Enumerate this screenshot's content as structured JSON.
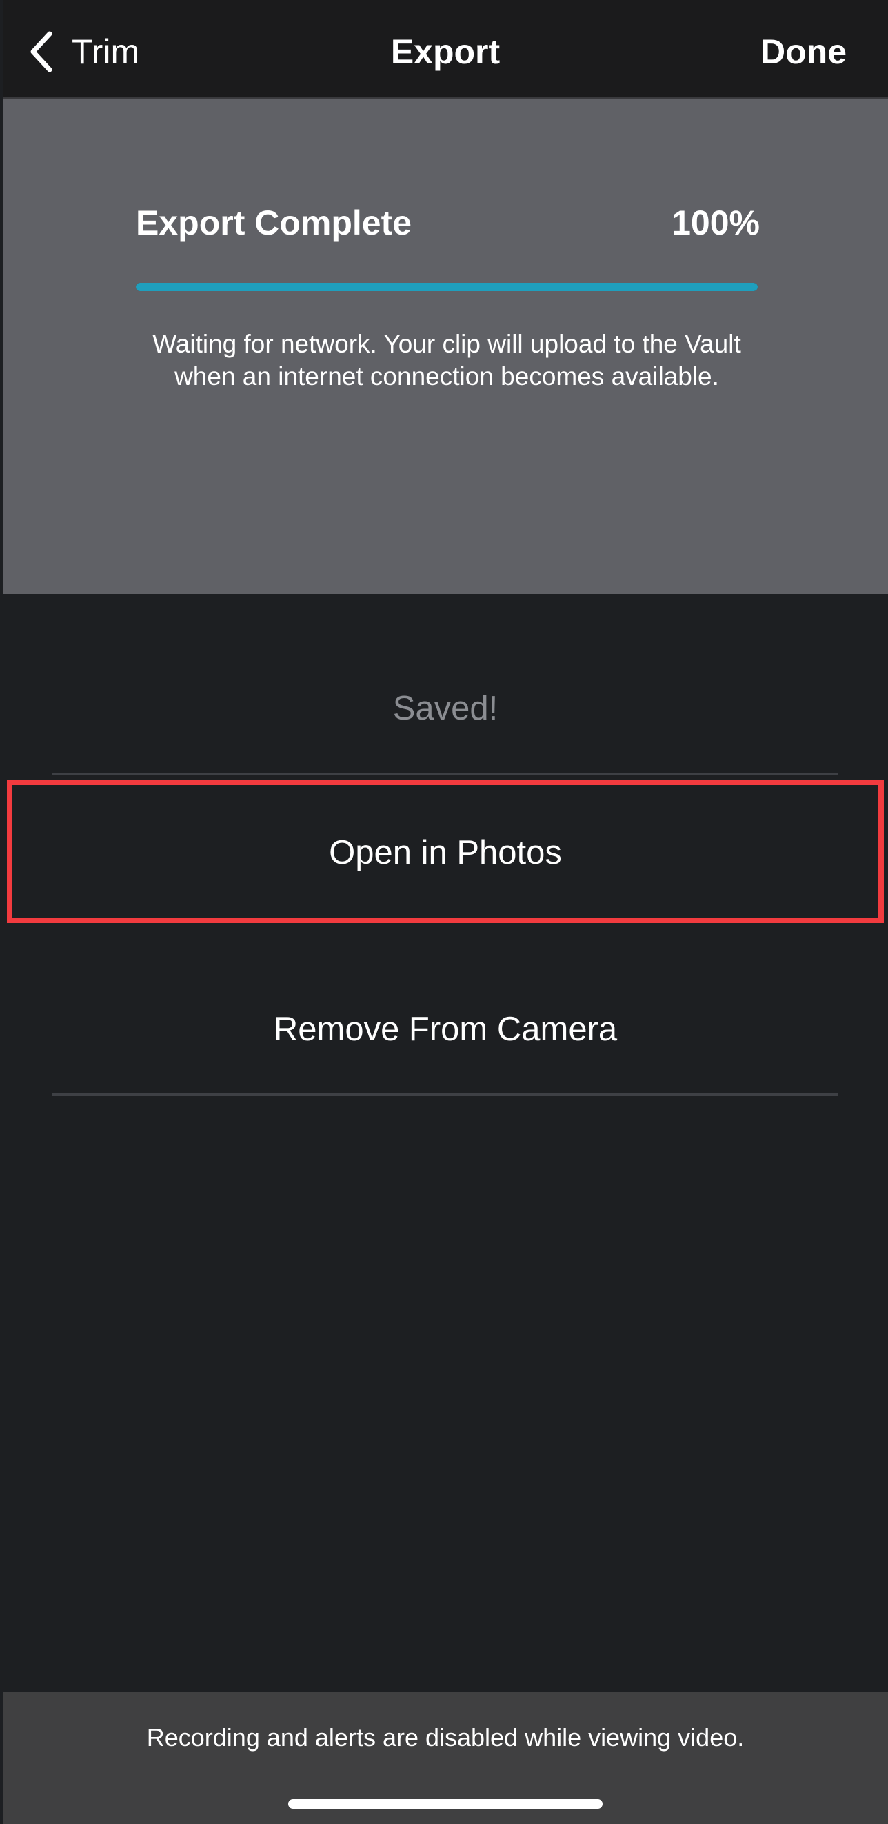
{
  "nav": {
    "back_label": "Trim",
    "title": "Export",
    "done_label": "Done"
  },
  "export_status": {
    "title": "Export Complete",
    "percent_text": "100%",
    "progress": 1.0,
    "message": "Waiting for network. Your clip will upload to the Vault when an internet connection becomes available.",
    "progress_color": "#1f9fbd"
  },
  "actions": {
    "saved_label": "Saved!",
    "open_photos_label": "Open in Photos",
    "remove_camera_label": "Remove From Camera"
  },
  "footer": {
    "notice": "Recording and alerts are disabled while viewing video."
  },
  "highlight_color": "#f23b3f",
  "icons": {
    "back": "chevron-left-icon"
  }
}
